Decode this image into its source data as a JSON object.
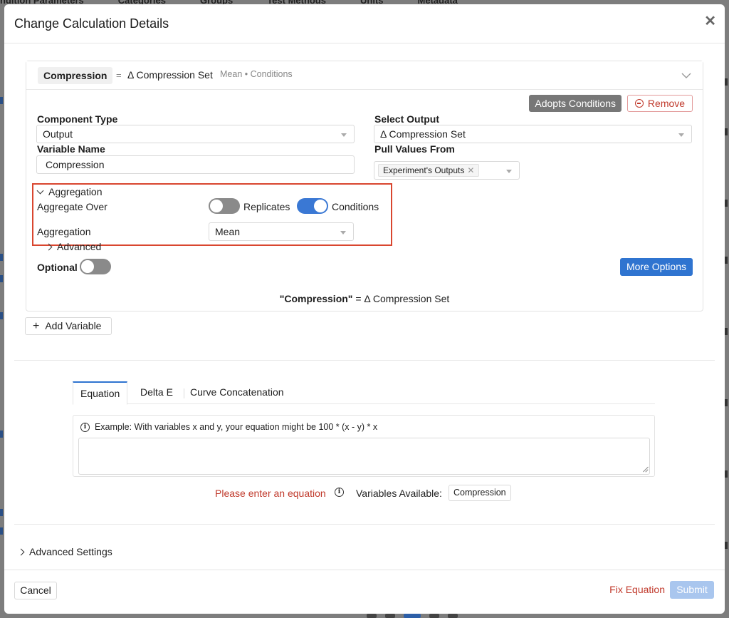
{
  "background": {
    "tabs": [
      "ndition Parameters",
      "Categories",
      "Groups",
      "Test Methods",
      "Units",
      "Metadata"
    ]
  },
  "modal": {
    "title": "Change Calculation Details"
  },
  "variable": {
    "name": "Compression",
    "equals": "=",
    "source": "Δ Compression Set",
    "meta": "Mean • Conditions",
    "adopts_label": "Adopts Conditions",
    "remove_label": "Remove",
    "component_type_label": "Component Type",
    "component_type_value": "Output",
    "variable_name_label": "Variable Name",
    "variable_name_value": "Compression",
    "select_output_label": "Select Output",
    "select_output_value": "Δ Compression Set",
    "pull_values_label": "Pull Values From",
    "pull_values_tag": "Experiment's Outputs",
    "aggregation_section_label": "Aggregation",
    "aggregate_over_label": "Aggregate Over",
    "replicates_label": "Replicates",
    "replicates_on": false,
    "conditions_label": "Conditions",
    "conditions_on": true,
    "aggregation_label": "Aggregation",
    "aggregation_value": "Mean",
    "advanced_label": "Advanced",
    "optional_label": "Optional",
    "optional_on": false,
    "more_options_label": "More Options",
    "summary_name": "\"Compression\"",
    "summary_eq": " = ",
    "summary_value": "Δ Compression Set"
  },
  "add_variable_label": "Add Variable",
  "tabs": [
    {
      "label": "Equation",
      "active": true
    },
    {
      "label": "Delta E",
      "active": false
    },
    {
      "label": "Curve Concatenation",
      "active": false
    }
  ],
  "equation": {
    "hint": "Example: With variables x and y, your equation might be 100 * (x - y) * x",
    "value": ""
  },
  "status": {
    "error": "Please enter an equation",
    "variables_available_label": "Variables Available:",
    "variables": [
      "Compression"
    ]
  },
  "advanced_settings_label": "Advanced Settings",
  "footer": {
    "cancel_label": "Cancel",
    "fix_label": "Fix Equation",
    "submit_label": "Submit"
  },
  "colors": {
    "primary": "#2f74d0",
    "danger": "#c0392b",
    "highlight": "#d9462f",
    "submit_disabled": "#a9c6ee"
  }
}
